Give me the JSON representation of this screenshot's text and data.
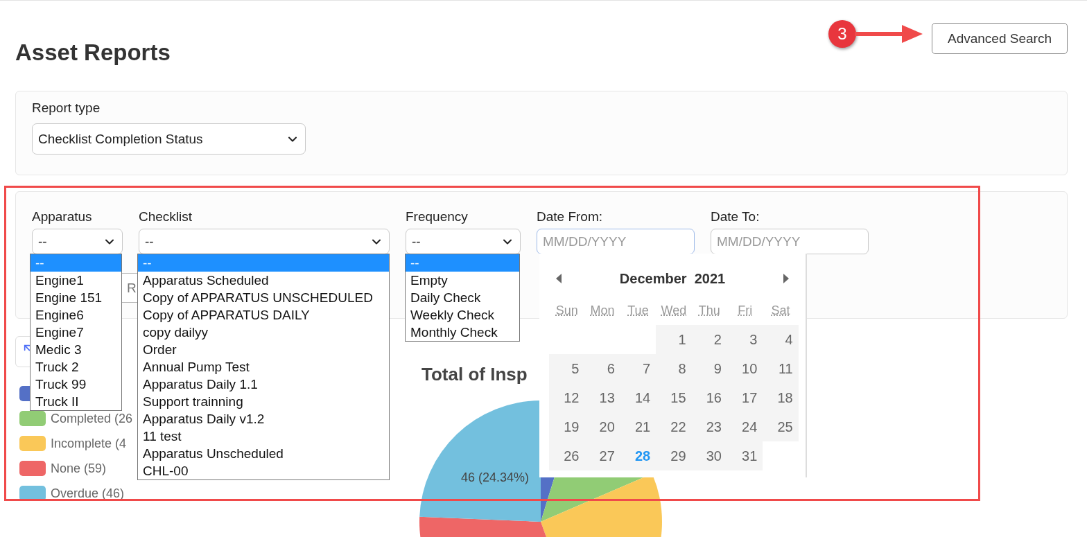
{
  "page": {
    "title": "Asset Reports",
    "advanced_search": "Advanced Search"
  },
  "report_type": {
    "label": "Report type",
    "value": "Checklist Completion Status"
  },
  "filters": [
    {
      "kind": "select",
      "label": "Apparatus",
      "value": "--",
      "expanded": true,
      "options": [
        {
          "label": "--",
          "selected": true
        },
        {
          "label": "Engine1",
          "selected": false
        },
        {
          "label": "Engine 151",
          "selected": false
        },
        {
          "label": "Engine6",
          "selected": false
        },
        {
          "label": "Engine7",
          "selected": false
        },
        {
          "label": "Medic 3",
          "selected": false
        },
        {
          "label": "Truck 2",
          "selected": false
        },
        {
          "label": "Truck 99",
          "selected": false
        },
        {
          "label": "Truck II",
          "selected": false
        }
      ]
    },
    {
      "kind": "select",
      "label": "Checklist",
      "value": "--",
      "expanded": true,
      "options": [
        {
          "label": "--",
          "selected": true
        },
        {
          "label": "Apparatus Scheduled",
          "selected": false
        },
        {
          "label": "Copy of APPARATUS UNSCHEDULED",
          "selected": false
        },
        {
          "label": "Copy of APPARATUS DAILY",
          "selected": false
        },
        {
          "label": "copy dailyy",
          "selected": false
        },
        {
          "label": "Order",
          "selected": false
        },
        {
          "label": "Annual Pump Test",
          "selected": false
        },
        {
          "label": "Apparatus Daily 1.1",
          "selected": false
        },
        {
          "label": "Support trainning",
          "selected": false
        },
        {
          "label": "Apparatus Daily v1.2",
          "selected": false
        },
        {
          "label": "11 test",
          "selected": false
        },
        {
          "label": "Apparatus Unscheduled",
          "selected": false
        },
        {
          "label": "CHL-00",
          "selected": false
        }
      ]
    },
    {
      "kind": "select",
      "label": "Frequency",
      "value": "--",
      "expanded": true,
      "options": [
        {
          "label": "--",
          "selected": true
        },
        {
          "label": "Empty",
          "selected": false
        },
        {
          "label": "Daily Check",
          "selected": false
        },
        {
          "label": "Weekly Check",
          "selected": false
        },
        {
          "label": "Monthly Check",
          "selected": false
        }
      ]
    },
    {
      "kind": "date",
      "label": "Date From:",
      "placeholder": "MM/DD/YYYY",
      "expanded": true
    },
    {
      "kind": "date",
      "label": "Date To:",
      "placeholder": "MM/DD/YYYY",
      "expanded": false
    }
  ],
  "run_button": "R",
  "calendar": {
    "month": "December",
    "year": "2021",
    "weekdays": [
      "Sun",
      "Mon",
      "Tue",
      "Wed",
      "Thu",
      "Fri",
      "Sat"
    ],
    "cells": [
      {
        "kind": "blank"
      },
      {
        "kind": "blank"
      },
      {
        "kind": "blank"
      },
      {
        "kind": "day",
        "day": "1",
        "selected": false
      },
      {
        "kind": "day",
        "day": "2",
        "selected": false
      },
      {
        "kind": "day",
        "day": "3",
        "selected": false
      },
      {
        "kind": "day",
        "day": "4",
        "selected": false
      },
      {
        "kind": "day",
        "day": "5",
        "selected": false
      },
      {
        "kind": "day",
        "day": "6",
        "selected": false
      },
      {
        "kind": "day",
        "day": "7",
        "selected": false
      },
      {
        "kind": "day",
        "day": "8",
        "selected": false
      },
      {
        "kind": "day",
        "day": "9",
        "selected": false
      },
      {
        "kind": "day",
        "day": "10",
        "selected": false
      },
      {
        "kind": "day",
        "day": "11",
        "selected": false
      },
      {
        "kind": "day",
        "day": "12",
        "selected": false
      },
      {
        "kind": "day",
        "day": "13",
        "selected": false
      },
      {
        "kind": "day",
        "day": "14",
        "selected": false
      },
      {
        "kind": "day",
        "day": "15",
        "selected": false
      },
      {
        "kind": "day",
        "day": "16",
        "selected": false
      },
      {
        "kind": "day",
        "day": "17",
        "selected": false
      },
      {
        "kind": "day",
        "day": "18",
        "selected": false
      },
      {
        "kind": "day",
        "day": "19",
        "selected": false
      },
      {
        "kind": "day",
        "day": "20",
        "selected": false
      },
      {
        "kind": "day",
        "day": "21",
        "selected": false
      },
      {
        "kind": "day",
        "day": "22",
        "selected": false
      },
      {
        "kind": "day",
        "day": "23",
        "selected": false
      },
      {
        "kind": "day",
        "day": "24",
        "selected": false
      },
      {
        "kind": "day",
        "day": "25",
        "selected": false
      },
      {
        "kind": "day",
        "day": "26",
        "selected": false
      },
      {
        "kind": "day",
        "day": "27",
        "selected": false
      },
      {
        "kind": "day",
        "day": "28",
        "selected": true
      },
      {
        "kind": "day",
        "day": "29",
        "selected": false
      },
      {
        "kind": "day",
        "day": "30",
        "selected": false
      },
      {
        "kind": "day",
        "day": "31",
        "selected": false
      }
    ]
  },
  "legend": [
    {
      "color": "#5470c6"
    },
    {
      "color": "#91cc75",
      "label": "Completed (26"
    },
    {
      "color": "#fac858",
      "label": "Incomplete (4"
    },
    {
      "color": "#ee6666",
      "label": "None (59)"
    },
    {
      "color": "#73c0de",
      "label": "Overdue (46)"
    }
  ],
  "chart": {
    "title": "Total of Insp",
    "slice_label": "46 (24.34%)"
  },
  "annotation": {
    "badge": "3"
  }
}
